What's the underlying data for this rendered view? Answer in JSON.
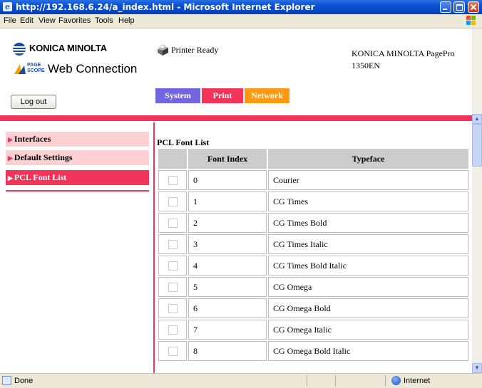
{
  "window": {
    "title": "http://192.168.6.24/a_index.html - Microsoft Internet Explorer"
  },
  "menubar": {
    "items": [
      "File",
      "Edit",
      "View",
      "Favorites",
      "Tools",
      "Help"
    ]
  },
  "header": {
    "brand": "KONICA MINOLTA",
    "pagescope_small": "PAGE SCOPE",
    "pagescope": "Web Connection",
    "printer_status": "Printer Ready",
    "model_line1": "KONICA MINOLTA PagePro",
    "model_line2": "1350EN",
    "logout_label": "Log out"
  },
  "tabs": [
    {
      "label": "System",
      "color": "#7266e0"
    },
    {
      "label": "Print",
      "color": "#f2345a"
    },
    {
      "label": "Network",
      "color": "#ff9a12"
    }
  ],
  "sidebar": {
    "items": [
      {
        "label": "Interfaces",
        "active": false
      },
      {
        "label": "Default Settings",
        "active": false
      },
      {
        "label": "PCL Font List",
        "active": true
      }
    ]
  },
  "main": {
    "section_title": "PCL Font List",
    "columns": [
      "",
      "Font Index",
      "Typeface"
    ],
    "rows": [
      {
        "index": "0",
        "typeface": "Courier"
      },
      {
        "index": "1",
        "typeface": "CG Times"
      },
      {
        "index": "2",
        "typeface": "CG Times Bold"
      },
      {
        "index": "3",
        "typeface": "CG Times Italic"
      },
      {
        "index": "4",
        "typeface": "CG Times Bold Italic"
      },
      {
        "index": "5",
        "typeface": "CG Omega"
      },
      {
        "index": "6",
        "typeface": "CG Omega Bold"
      },
      {
        "index": "7",
        "typeface": "CG Omega Italic"
      },
      {
        "index": "8",
        "typeface": "CG Omega Bold Italic"
      }
    ]
  },
  "statusbar": {
    "left": "Done",
    "zone": "Internet"
  },
  "colors": {
    "accent": "#f2345a",
    "sidebar_bg": "#fcd0d0",
    "xp_blue": "#0a4fd1"
  }
}
